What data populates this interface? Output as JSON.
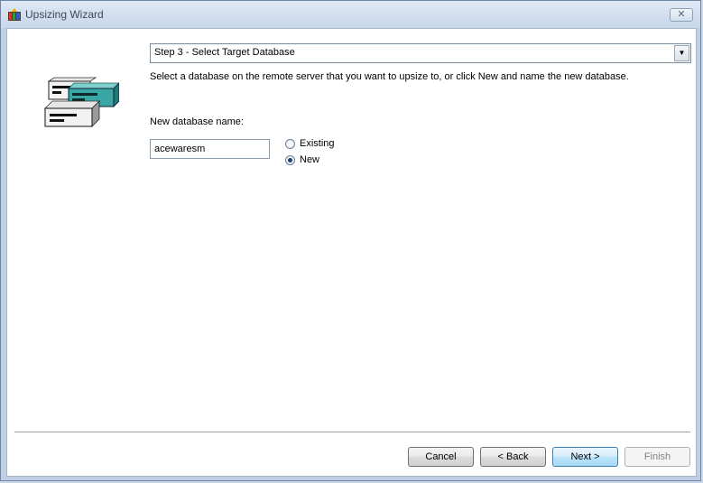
{
  "window": {
    "title": "Upsizing Wizard",
    "close_glyph": "✕"
  },
  "step_selector": {
    "value": "Step 3 - Select Target Database"
  },
  "instruction": "Select a database on the remote server that you want to upsize to, or click New and name the new database.",
  "new_database": {
    "label": "New database name:",
    "value": "acewaresm"
  },
  "radios": [
    {
      "label": "Existing",
      "checked": false
    },
    {
      "label": "New",
      "checked": true
    }
  ],
  "buttons": {
    "cancel": "Cancel",
    "back": "< Back",
    "next": "Next >",
    "finish": "Finish"
  },
  "icons": {
    "app": "wizard-app-icon",
    "art": "database-servers-icon",
    "dropdown": "chevron-down-icon"
  },
  "colors": {
    "title_bar": "#c8d7ea",
    "default_button": "#bee6fd",
    "server_teal": "#3aa7a6"
  }
}
